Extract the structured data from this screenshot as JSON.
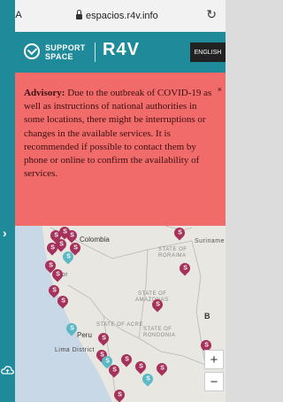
{
  "browser": {
    "aa_label": "AA",
    "url": "espacios.r4v.info",
    "reload_icon": "reload-icon"
  },
  "header": {
    "brand_line1": "SUPPORT",
    "brand_line2": "SPACE",
    "r4v_logo": "R4V",
    "language_button": "ENGLISH",
    "colors": {
      "header_bg": "#1f8b9a",
      "language_bg": "#222222"
    }
  },
  "advisory": {
    "title": "Advisory:",
    "body": " Due to the outbreak of COVID-19 as well as instructions of national authorities in some locations, there might be interruptions or changes in the available services. It is recommended if possible to contact them by phone or online to confirm the availability of services.",
    "close_label": "×",
    "background": "#f26b6b"
  },
  "map": {
    "labels": {
      "colombia": "Colombia",
      "suriname": "Suriname",
      "ador": "ador",
      "roraima_1": "STATE OF",
      "roraima_2": "RORAIMA",
      "amazonas_1": "STATE OF",
      "amazonas_2": "AMAZONAS",
      "acre": "STATE OF ACRE",
      "rondonia_1": "STATE OF",
      "rondonia_2": "RONDONIA",
      "peru": "Peru",
      "lima": "Lima District",
      "b_label": "B"
    },
    "pin_letter": "S",
    "pin_color": "#a6315a",
    "pin_color_alt": "#5bb8c4",
    "zoom_in": "+",
    "zoom_out": "−",
    "sidebar_toggle": "›"
  }
}
